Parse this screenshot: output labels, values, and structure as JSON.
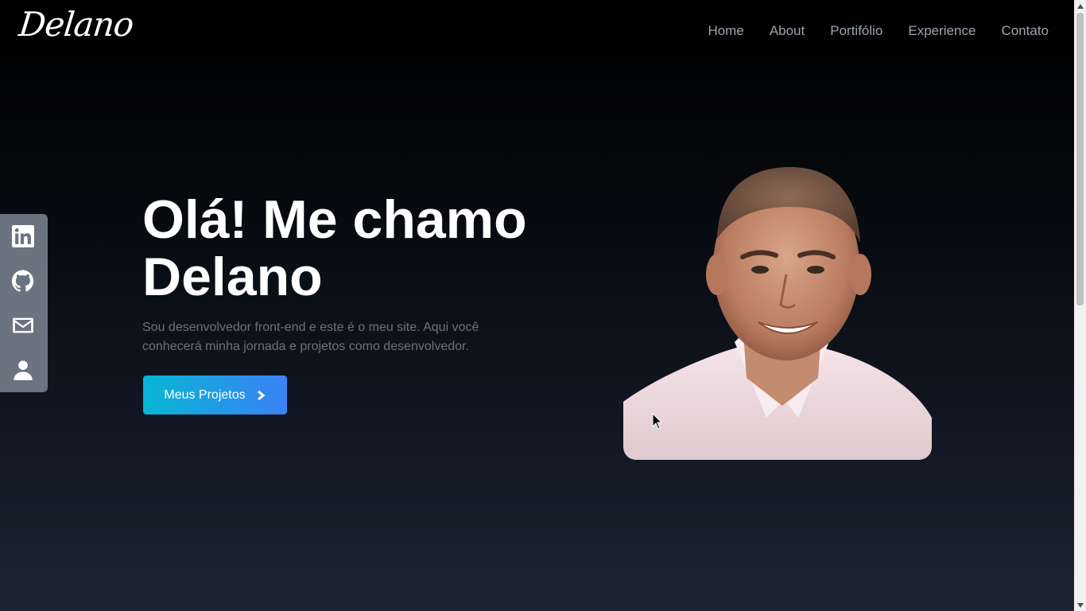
{
  "brand": {
    "logo_text": "Delano"
  },
  "nav": {
    "items": [
      {
        "label": "Home"
      },
      {
        "label": "About"
      },
      {
        "label": "Portifólio"
      },
      {
        "label": "Experience"
      },
      {
        "label": "Contato"
      }
    ]
  },
  "social": {
    "items": [
      {
        "icon": "linkedin-icon"
      },
      {
        "icon": "github-icon"
      },
      {
        "icon": "mail-icon"
      },
      {
        "icon": "user-icon"
      }
    ]
  },
  "hero": {
    "title": "Olá! Me chamo Delano",
    "description": "Sou desenvolvedor front-end e este é o meu site. Aqui você conhecerá minha jornada e projetos como desenvolvedor.",
    "cta_label": "Meus Projetos"
  },
  "colors": {
    "nav_text": "#9ca3af",
    "cta_gradient_start": "#06b6d4",
    "cta_gradient_end": "#3b82f6",
    "social_bar": "#6b7280"
  }
}
